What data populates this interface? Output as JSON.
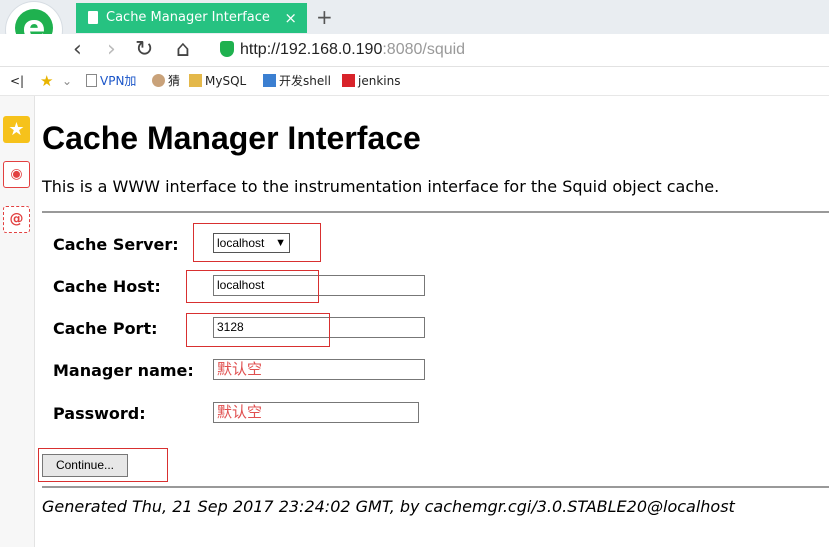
{
  "browser": {
    "tab_title": "Cache Manager Interface",
    "tab_close": "×",
    "new_tab": "+",
    "url_host": "http://192.168.0.190",
    "url_port": ":8080/squid",
    "nav": {
      "back": "‹",
      "forward": "›",
      "reload": "↻",
      "home": "⌂"
    }
  },
  "bookmarks": {
    "collapse": "<|",
    "favorites_arrow": "⌄",
    "items": [
      "VPN加",
      "猜",
      "MySQL",
      "开发shell",
      "jenkins"
    ]
  },
  "page": {
    "title": "Cache Manager Interface",
    "intro": "This is a WWW interface to the instrumentation interface for the Squid object cache.",
    "form": {
      "cache_server_label": "Cache Server:",
      "cache_server_value": "localhost",
      "cache_host_label": "Cache Host:",
      "cache_host_value": "localhost",
      "cache_port_label": "Cache Port:",
      "cache_port_value": "3128",
      "manager_label": "Manager name:",
      "manager_value": "默认空",
      "password_label": "Password:",
      "password_value": "默认空",
      "submit_label": "Continue..."
    },
    "footer": "Generated Thu, 21 Sep 2017 23:24:02 GMT, by cachemgr.cgi/3.0.STABLE20@localhost"
  },
  "colors": {
    "tab": "#26c281",
    "annotation": "#d83030",
    "hint_text": "#e05050"
  }
}
